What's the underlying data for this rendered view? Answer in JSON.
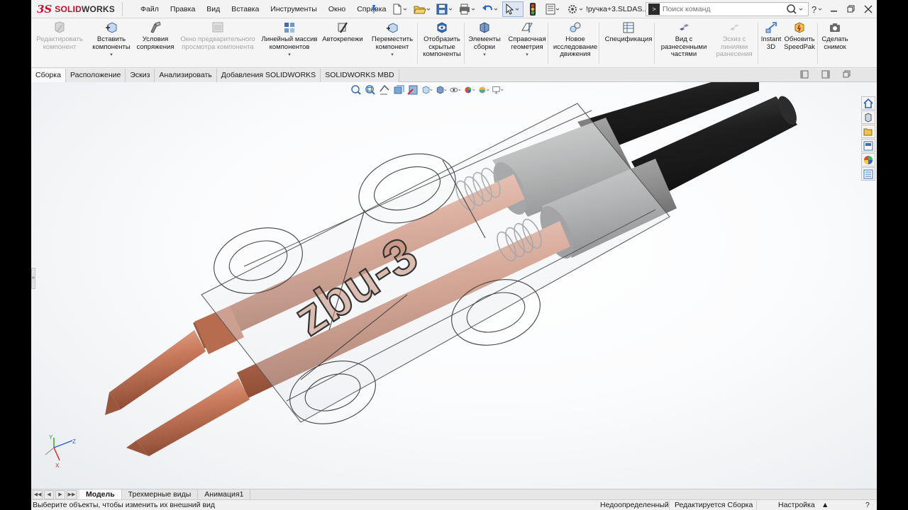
{
  "app": {
    "brand_ds": "3S",
    "brand_name_a": "SOLID",
    "brand_name_b": "WORKS",
    "document_title": "!ручка+3.SLDAS..."
  },
  "menu": [
    "Файл",
    "Правка",
    "Вид",
    "Вставка",
    "Инструменты",
    "Окно",
    "Справка"
  ],
  "quick_toolbar": [
    "new-icon",
    "open-icon",
    "save-icon",
    "print-icon",
    "undo-icon",
    "select-icon",
    "traffic-light-icon",
    "file-properties-icon",
    "options-icon"
  ],
  "search": {
    "placeholder": "Поиск команд",
    "value": ""
  },
  "window_controls": [
    "help-icon",
    "minimize-icon",
    "restore-icon",
    "close-icon"
  ],
  "ribbon": [
    {
      "label": "Редактировать компонент",
      "icon": "edit-component-icon",
      "enabled": false
    },
    {
      "label": "Вставить компоненты",
      "icon": "insert-components-icon",
      "enabled": true,
      "dropdown": true
    },
    {
      "label": "Условия сопряжения",
      "icon": "mate-icon",
      "enabled": true
    },
    {
      "label": "Окно предварительного просмотра компонента",
      "icon": "preview-window-icon",
      "enabled": false
    },
    {
      "label": "Линейный массив компонентов",
      "icon": "linear-pattern-icon",
      "enabled": true,
      "dropdown": true
    },
    {
      "label": "Автокрепежи",
      "icon": "smart-fasteners-icon",
      "enabled": true
    },
    {
      "label": "Переместить компонент",
      "icon": "move-component-icon",
      "enabled": true,
      "dropdown": true
    },
    {
      "label": "Отобразить скрытые компоненты",
      "icon": "show-hidden-icon",
      "enabled": true
    },
    {
      "label": "Элементы сборки",
      "icon": "assembly-features-icon",
      "enabled": true,
      "dropdown": true
    },
    {
      "label": "Справочная геометрия",
      "icon": "reference-geometry-icon",
      "enabled": true,
      "dropdown": true
    },
    {
      "label": "Новое исследование движения",
      "icon": "motion-study-icon",
      "enabled": true
    },
    {
      "label": "Спецификация",
      "icon": "bill-of-materials-icon",
      "enabled": true
    },
    {
      "label": "Вид с разнесенными частями",
      "icon": "exploded-view-icon",
      "enabled": true
    },
    {
      "label": "Эскиз с линиями разнесения",
      "icon": "explode-line-sketch-icon",
      "enabled": false
    },
    {
      "label": "Instant 3D",
      "icon": "instant3d-icon",
      "enabled": true
    },
    {
      "label": "Обновить SpeedPak",
      "icon": "speedpak-icon",
      "enabled": true
    },
    {
      "label": "Сделать снимок",
      "icon": "snapshot-icon",
      "enabled": true
    }
  ],
  "tabs": [
    {
      "label": "Сборка",
      "active": true
    },
    {
      "label": "Расположение",
      "active": false
    },
    {
      "label": "Эскиз",
      "active": false
    },
    {
      "label": "Анализировать",
      "active": false
    },
    {
      "label": "Добавления SOLIDWORKS",
      "active": false
    },
    {
      "label": "SOLIDWORKS MBD",
      "active": false
    }
  ],
  "viewport": {
    "model_label": "zbu-3",
    "heads_up_toolbar": [
      "zoom-to-fit-icon",
      "zoom-area-icon",
      "previous-view-icon",
      "section-view-icon",
      "dynamic-annotation-icon",
      "view-orientation-icon",
      "display-style-icon",
      "hide-show-icon",
      "edit-appearance-icon",
      "apply-scene-icon",
      "view-settings-icon"
    ],
    "task_pane": [
      "home-icon",
      "design-library-icon",
      "file-explorer-icon",
      "view-palette-icon",
      "appearances-icon",
      "custom-properties-icon"
    ],
    "triad_axes": [
      "Y",
      "Z",
      "X"
    ]
  },
  "bottom_tabs": [
    {
      "label": "Модель",
      "active": true
    },
    {
      "label": "Трехмерные виды",
      "active": false
    },
    {
      "label": "Анимация1",
      "active": false
    }
  ],
  "status": {
    "hint": "Выберите объекты, чтобы изменить их внешний вид",
    "definition": "Недоопределенный",
    "editing": "Редактируется Сборка",
    "units": "Настройка"
  },
  "colors": {
    "brand": "#c8102e",
    "copper": "#c97a5c",
    "cable": "#2a2a2a",
    "sleeve": "#8a8a8a"
  }
}
